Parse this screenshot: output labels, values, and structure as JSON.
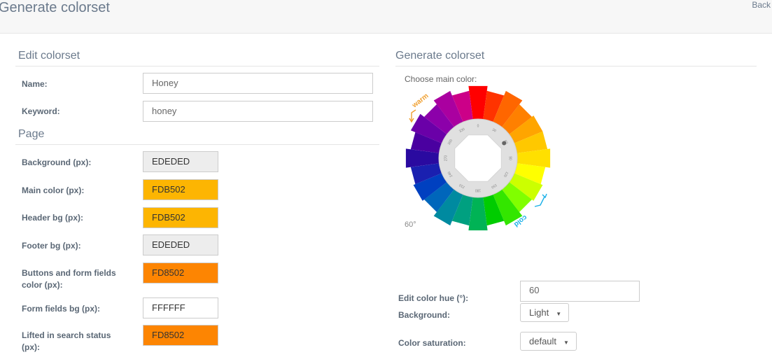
{
  "header": {
    "title": "Generate colorset",
    "back_label": "Back"
  },
  "edit_section": {
    "title": "Edit colorset",
    "name_label": "Name:",
    "name_value": "Honey",
    "keyword_label": "Keyword:",
    "keyword_value": "honey"
  },
  "page_section": {
    "title": "Page",
    "rows": [
      {
        "label": "Background (px):",
        "value": "EDEDED",
        "color": "#EDEDED"
      },
      {
        "label": "Main color (px):",
        "value": "FDB502",
        "color": "#FDB502"
      },
      {
        "label": "Header bg (px):",
        "value": "FDB502",
        "color": "#FDB502"
      },
      {
        "label": "Footer bg (px):",
        "value": "EDEDED",
        "color": "#EDEDED"
      },
      {
        "label": "Buttons and form fields color (px):",
        "value": "FD8502",
        "color": "#FD8502"
      },
      {
        "label": "Form fields bg (px):",
        "value": "FFFFFF",
        "color": "#FFFFFF"
      },
      {
        "label": "Lifted in search status (px):",
        "value": "FD8502",
        "color": "#FD8502"
      }
    ]
  },
  "generate_section": {
    "title": "Generate colorset",
    "choose_label": "Choose main color:",
    "warm_label": "warm",
    "cold_label": "cold",
    "degree_label": "60°",
    "ring_ticks": [
      "0",
      "30",
      "60",
      "90",
      "120",
      "150",
      "180",
      "210",
      "240",
      "270",
      "300",
      "330"
    ],
    "hue_label": "Edit color hue (°):",
    "hue_value": "60",
    "background_label": "Background:",
    "background_value": "Light",
    "saturation_label": "Color saturation:",
    "saturation_value": "default"
  }
}
